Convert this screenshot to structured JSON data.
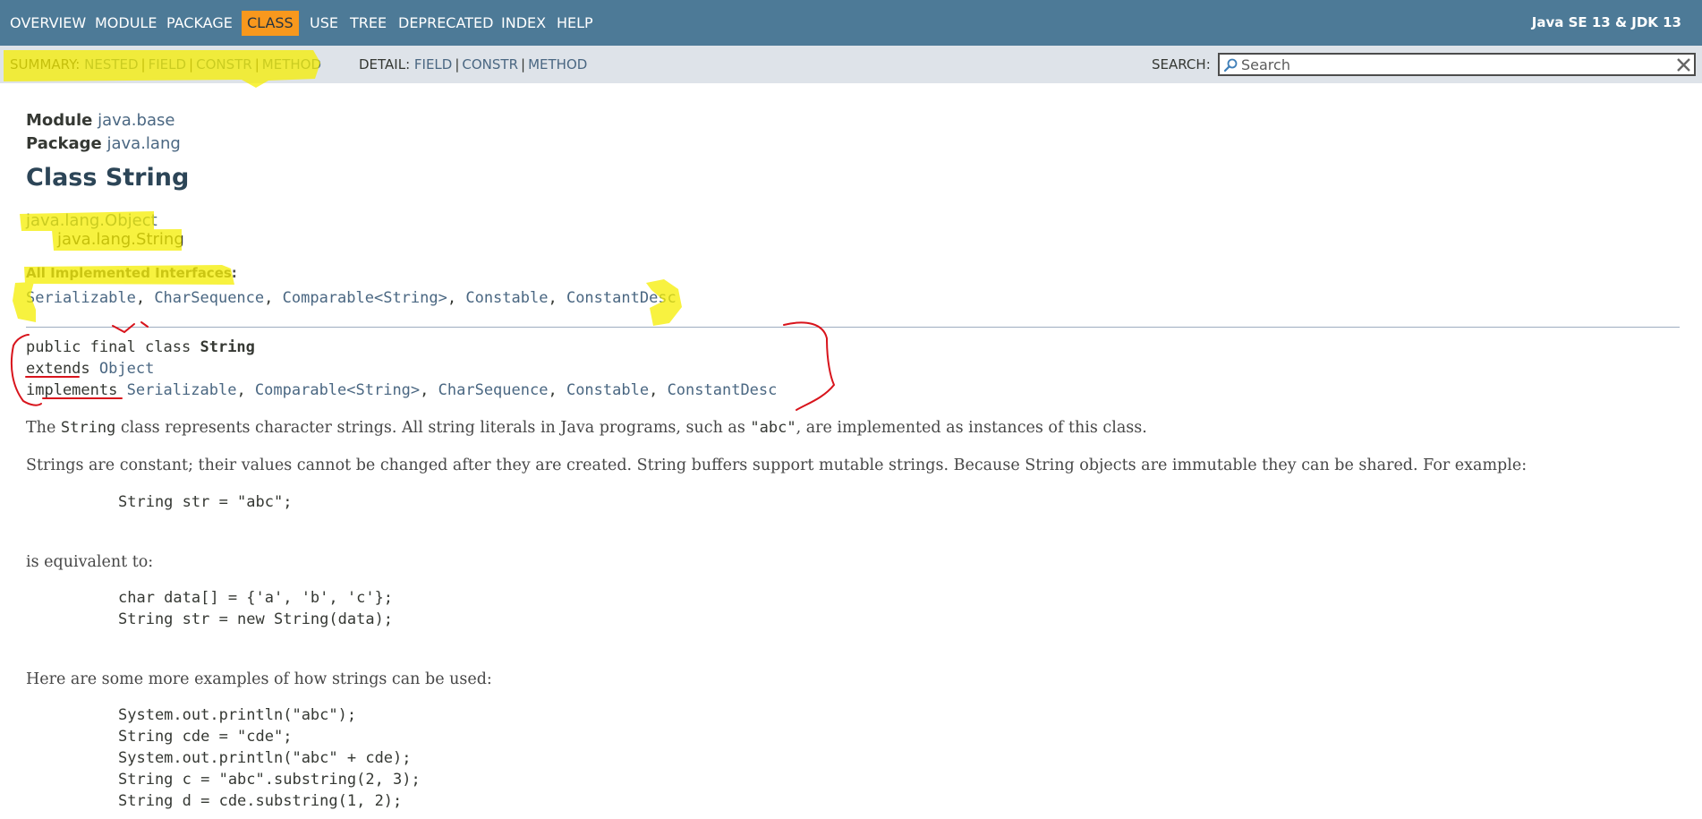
{
  "topnav": {
    "items": [
      "OVERVIEW",
      "MODULE",
      "PACKAGE",
      "CLASS",
      "USE",
      "TREE",
      "DEPRECATED",
      "INDEX",
      "HELP"
    ],
    "active": "CLASS",
    "about": "Java SE 13 & JDK 13"
  },
  "subnav": {
    "summary_label": "SUMMARY:",
    "summary": [
      "NESTED",
      "FIELD",
      "CONSTR",
      "METHOD"
    ],
    "detail_label": "DETAIL:",
    "detail": [
      "FIELD",
      "CONSTR",
      "METHOD"
    ],
    "search_label": "SEARCH:",
    "search_placeholder": "Search"
  },
  "header": {
    "module_label": "Module",
    "module_name": "java.base",
    "package_label": "Package",
    "package_name": "java.lang",
    "title": "Class String"
  },
  "inheritance": [
    "java.lang.Object",
    "java.lang.String"
  ],
  "interfaces": {
    "label": "All Implemented Interfaces:",
    "items": [
      "Serializable",
      "CharSequence",
      "Comparable<String>",
      "Constable",
      "ConstantDesc"
    ]
  },
  "signature": {
    "modifiers": "public final class",
    "name": "String",
    "extends_kw": "extends",
    "extends": "Object",
    "implements_kw": "implements",
    "implements": [
      "Serializable",
      "Comparable<String>",
      "CharSequence",
      "Constable",
      "ConstantDesc"
    ]
  },
  "description": {
    "p1_before": "The ",
    "p1_code": "String",
    "p1_middle": " class represents character strings. All string literals in Java programs, such as ",
    "p1_code2": "\"abc\"",
    "p1_after": ", are implemented as instances of this class.",
    "p2": "Strings are constant; their values cannot be changed after they are created. String buffers support mutable strings. Because String objects are immutable they can be shared. For example:",
    "code1": [
      "String str = \"abc\";"
    ],
    "p3": "is equivalent to:",
    "code2": [
      "char data[] = {'a', 'b', 'c'};",
      "String str = new String(data);"
    ],
    "p4": "Here are some more examples of how strings can be used:",
    "code3": [
      "System.out.println(\"abc\");",
      "String cde = \"cde\";",
      "System.out.println(\"abc\" + cde);",
      "String c = \"abc\".substring(2, 3);",
      "String d = cde.substring(1, 2);"
    ]
  },
  "colors": {
    "nav_bg": "#4d7a97",
    "active_tab": "#f8981d",
    "subnav_bg": "#dee3e9",
    "link": "#4a6782",
    "highlighter": "#f5ee00",
    "pen": "#d8141c"
  }
}
